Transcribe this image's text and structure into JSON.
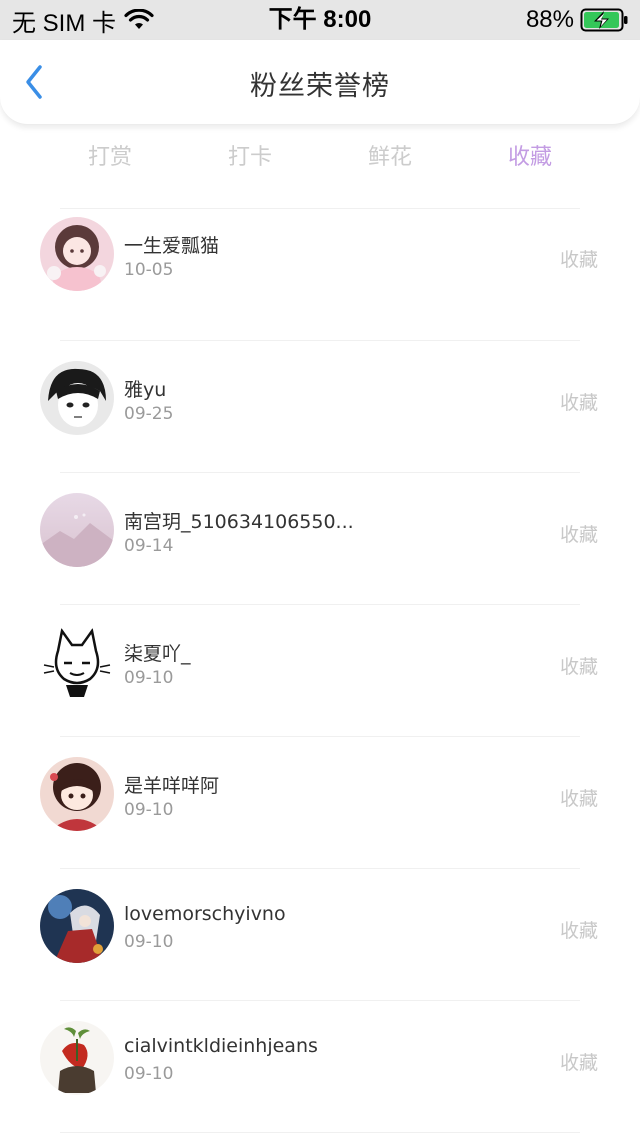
{
  "status_bar": {
    "carrier": "无 SIM 卡",
    "time": "下午 8:00",
    "battery": "88%"
  },
  "header": {
    "title": "粉丝荣誉榜",
    "back_icon": "chevron-left-icon"
  },
  "tabs": [
    {
      "label": "打赏",
      "active": false
    },
    {
      "label": "打卡",
      "active": false
    },
    {
      "label": "鲜花",
      "active": false
    },
    {
      "label": "收藏",
      "active": true
    }
  ],
  "colors": {
    "accent": "#c39ce3",
    "back_icon": "#3a8ee6",
    "battery_fill": "#34c759"
  },
  "list": [
    {
      "name": "一生爱瓢猫",
      "date": "10-05",
      "action": "收藏"
    },
    {
      "name": "雅yu",
      "date": "09-25",
      "action": "收藏"
    },
    {
      "name": "南宫玥_510634106550...",
      "date": "09-14",
      "action": "收藏"
    },
    {
      "name": "柒夏吖_",
      "date": "09-10",
      "action": "收藏"
    },
    {
      "name": "是羊咩咩阿",
      "date": "09-10",
      "action": "收藏"
    },
    {
      "name": "lovemorschyivno",
      "date": "09-10",
      "action": "收藏"
    },
    {
      "name": "cialvintkldieinhjeans",
      "date": "09-10",
      "action": "收藏"
    }
  ]
}
